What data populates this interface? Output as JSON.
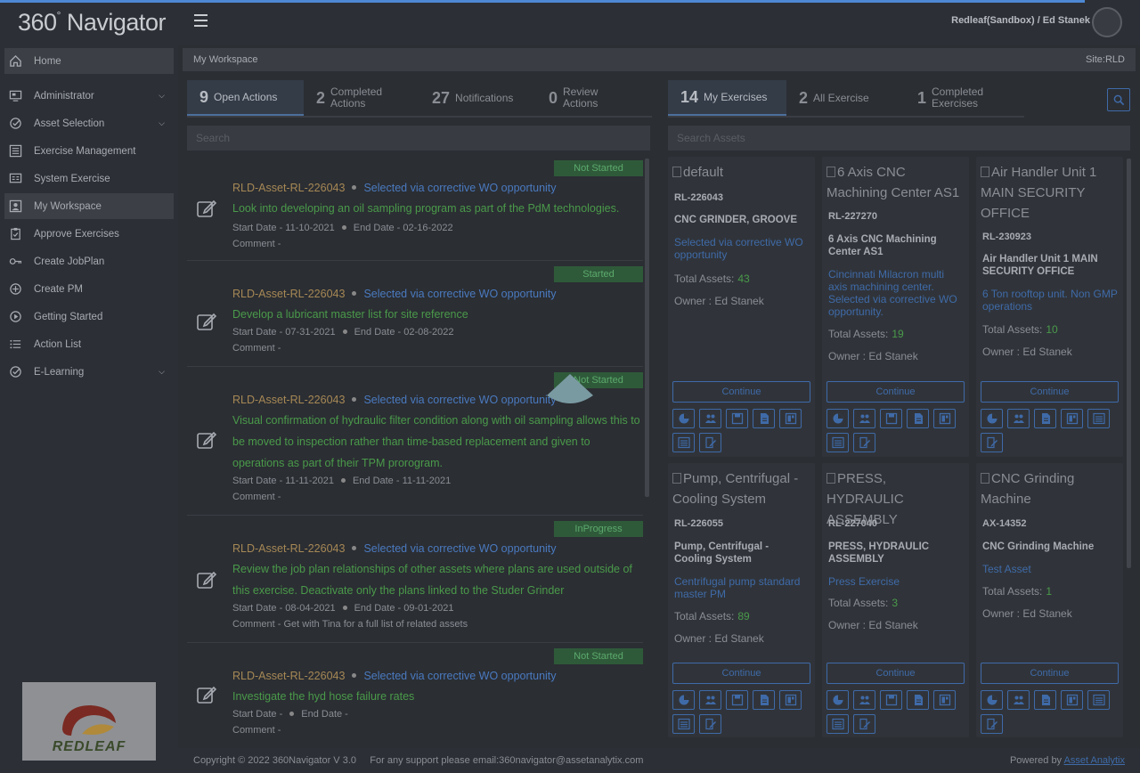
{
  "app": {
    "logo_number": "360",
    "logo_name": "Navigator",
    "user": "Redleaf(Sandbox) / Ed Stanek"
  },
  "sidebar": {
    "items": [
      {
        "label": "Home",
        "icon": "home-icon",
        "active": true
      },
      {
        "label": "Administrator",
        "icon": "admin-icon",
        "chevron": true
      },
      {
        "label": "Asset Selection",
        "icon": "check-circle-icon",
        "chevron": true
      },
      {
        "label": "Exercise Management",
        "icon": "list-icon"
      },
      {
        "label": "System Exercise",
        "icon": "monitor-list-icon"
      },
      {
        "label": "My Workspace",
        "icon": "user-box-icon",
        "active": true
      },
      {
        "label": "Approve Exercises",
        "icon": "clipboard-check-icon"
      },
      {
        "label": "Create JobPlan",
        "icon": "key-icon"
      },
      {
        "label": "Create PM",
        "icon": "plus-circle-icon"
      },
      {
        "label": "Getting Started",
        "icon": "play-circle-icon"
      },
      {
        "label": "Action List",
        "icon": "bullet-list-icon"
      },
      {
        "label": "E-Learning",
        "icon": "check-circle-icon",
        "chevron": true
      }
    ],
    "logo_text": "REDLEAF"
  },
  "breadcrumb": {
    "title": "My Workspace",
    "site": "Site:RLD"
  },
  "left_tabs": [
    {
      "num": "9",
      "label": "Open Actions",
      "active": true
    },
    {
      "num": "2",
      "label": "Completed Actions"
    },
    {
      "num": "27",
      "label": "Notifications"
    },
    {
      "num": "0",
      "label": "Review Actions"
    }
  ],
  "right_tabs": [
    {
      "num": "14",
      "label": "My Exercises",
      "active": true
    },
    {
      "num": "2",
      "label": "All Exercise"
    },
    {
      "num": "1",
      "label": "Completed Exercises"
    }
  ],
  "search": {
    "actions_placeholder": "Search",
    "assets_placeholder": "Search Assets"
  },
  "actions": [
    {
      "status": "Not Started",
      "asset": "RLD-Asset-RL-226043",
      "link": "Selected via corrective WO opportunity",
      "desc": "Look into developing an oil sampling program as part of the PdM technologies.",
      "start": "Start Date - 11-10-2021",
      "end": "End Date - 02-16-2022",
      "comment": "Comment -"
    },
    {
      "status": "Started",
      "asset": "RLD-Asset-RL-226043",
      "link": "Selected via corrective WO opportunity",
      "desc": "Develop a lubricant master list for site reference",
      "start": "Start Date - 07-31-2021",
      "end": "End Date - 02-08-2022",
      "comment": "Comment -"
    },
    {
      "status": "Not Started",
      "asset": "RLD-Asset-RL-226043",
      "link": "Selected via corrective WO opportunity",
      "desc": "Visual confirmation of hydraulic filter condition along with oil sampling allows this to be moved to inspection rather than time-based replacement and given to operations as part of their TPM prorogram.",
      "start": "Start Date - 11-11-2021",
      "end": "End Date - 11-11-2021",
      "comment": "Comment -"
    },
    {
      "status": "InProgress",
      "asset": "RLD-Asset-RL-226043",
      "link": "Selected via corrective WO opportunity",
      "desc": "Review the job plan relationships of other assets where plans are used outside of this exercise. Deactivate only the plans linked to the Studer Grinder",
      "start": "Start Date - 08-04-2021",
      "end": "End Date - 09-01-2021",
      "comment": "Comment - Get with Tina for a full list of related assets"
    },
    {
      "status": "Not Started",
      "asset": "RLD-Asset-RL-226043",
      "link": "Selected via corrective WO opportunity",
      "desc": "Investigate the hyd hose failure rates",
      "start": "Start Date -",
      "end": "End Date -",
      "comment": "Comment -"
    }
  ],
  "exercises": [
    {
      "img_alt": "default",
      "code": "RL-226043",
      "name": "CNC GRINDER, GROOVE",
      "desc": "Selected via corrective WO opportunity",
      "total_label": "Total Assets:",
      "total": "43",
      "owner": "Owner : Ed Stanek",
      "continue": "Continue"
    },
    {
      "img_alt": "6 Axis CNC Machining Center AS1",
      "code": "RL-227270",
      "name": "6 Axis CNC Machining Center AS1",
      "desc": "Cincinnati Milacron multi axis machining center. Selected via corrective WO opportunity.",
      "total_label": "Total Assets:",
      "total": "19",
      "owner": "Owner : Ed Stanek",
      "continue": "Continue"
    },
    {
      "img_alt": "Air Handler Unit 1 MAIN SECURITY OFFICE",
      "code": "RL-230923",
      "name": "Air Handler Unit 1 MAIN SECURITY OFFICE",
      "desc": "6 Ton rooftop unit. Non GMP operations",
      "total_label": "Total Assets:",
      "total": "10",
      "owner": "Owner : Ed Stanek",
      "continue": "Continue"
    },
    {
      "img_alt": "Pump, Centrifugal - Cooling System",
      "code": "RL-226055",
      "name": "Pump, Centrifugal - Cooling System",
      "desc": "Centrifugal pump standard master PM",
      "total_label": "Total Assets:",
      "total": "89",
      "owner": "Owner : Ed Stanek",
      "continue": "Continue"
    },
    {
      "img_alt": "PRESS, HYDRAULIC ASSEMBLY",
      "code": "RL-227040",
      "name": "PRESS, HYDRAULIC ASSEMBLY",
      "desc": "Press Exercise",
      "total_label": "Total Assets:",
      "total": "3",
      "owner": "Owner : Ed Stanek",
      "continue": "Continue"
    },
    {
      "img_alt": "CNC Grinding Machine",
      "code": "AX-14352",
      "name": "CNC Grinding Machine",
      "desc": "Test Asset",
      "total_label": "Total Assets:",
      "total": "1",
      "owner": "Owner : Ed Stanek",
      "continue": "Continue"
    }
  ],
  "footer": {
    "copyright": "Copyright © 2022 360Navigator V 3.0     For any support please email:360navigator@assetanalytix.com",
    "powered_label": "Powered by",
    "powered_link": "Asset Analytix"
  },
  "colors": {
    "accent": "#4d88d4",
    "status_green": "#5caa6c",
    "link_blue": "#3f6aa8",
    "asset_gold": "#a68855"
  }
}
